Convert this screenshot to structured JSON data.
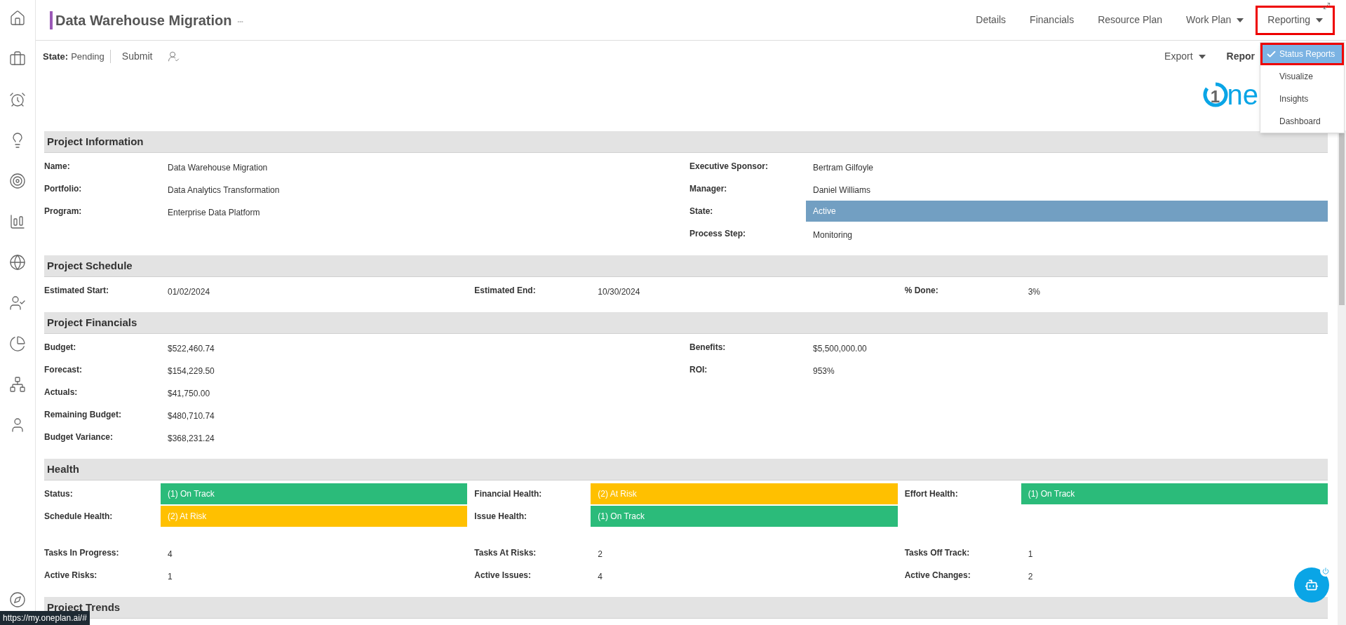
{
  "header": {
    "title": "Data Warehouse Migration",
    "more": "•••",
    "nav": [
      {
        "label": "Details",
        "dropdown": false,
        "selected": false
      },
      {
        "label": "Financials",
        "dropdown": false,
        "selected": false
      },
      {
        "label": "Resource Plan",
        "dropdown": false,
        "selected": false
      },
      {
        "label": "Work Plan",
        "dropdown": true,
        "selected": false
      },
      {
        "label": "Reporting",
        "dropdown": true,
        "selected": true
      }
    ]
  },
  "toolbar": {
    "state_label": "State:",
    "state_value": "Pending",
    "submit": "Submit",
    "export": "Export",
    "reports": "Repor"
  },
  "menu": [
    {
      "label": "Status Reports",
      "selected": true
    },
    {
      "label": "Visualize",
      "selected": false
    },
    {
      "label": "Insights",
      "selected": false
    },
    {
      "label": "Dashboard",
      "selected": false
    }
  ],
  "logo": {
    "mark": "1",
    "text": "ne"
  },
  "sections": [
    {
      "title": "Project Information",
      "blocks": [
        [
          [
            {
              "label": "Name:",
              "value": "Data Warehouse Migration"
            },
            {
              "label": "Portfolio:",
              "value": "Data Analytics Transformation"
            },
            {
              "label": "Program:",
              "value": "Enterprise Data Platform"
            }
          ],
          [
            {
              "label": "Executive Sponsor:",
              "value": "Bertram Gilfoyle"
            },
            {
              "label": "Manager:",
              "value": "Daniel Williams"
            },
            {
              "label": "State:",
              "value": "Active",
              "color": "#729fc2"
            },
            {
              "label": "Process Step:",
              "value": "Monitoring"
            }
          ]
        ]
      ]
    },
    {
      "title": "Project Schedule",
      "blocks": [
        [
          [
            {
              "label": "Estimated Start:",
              "value": "01/02/2024"
            }
          ],
          [
            {
              "label": "Estimated End:",
              "value": "10/30/2024"
            }
          ],
          [
            {
              "label": "% Done:",
              "value": "3%"
            }
          ]
        ]
      ]
    },
    {
      "title": "Project Financials",
      "blocks": [
        [
          [
            {
              "label": "Budget:",
              "value": "$522,460.74"
            },
            {
              "label": "Forecast:",
              "value": "$154,229.50"
            },
            {
              "label": "Actuals:",
              "value": "$41,750.00"
            },
            {
              "label": "Remaining Budget:",
              "value": "$480,710.74"
            },
            {
              "label": "Budget Variance:",
              "value": "$368,231.24"
            }
          ],
          [
            {
              "label": "Benefits:",
              "value": "$5,500,000.00"
            },
            {
              "label": "ROI:",
              "value": "953%"
            }
          ]
        ]
      ]
    },
    {
      "title": "Health",
      "blocks": [
        [
          [
            {
              "label": "Status:",
              "value": "(1) On Track",
              "color": "#2bbb7a"
            },
            {
              "label": "Schedule Health:",
              "value": "(2) At Risk",
              "color": "#ffc000"
            }
          ],
          [
            {
              "label": "Financial Health:",
              "value": "(2) At Risk",
              "color": "#ffc000"
            },
            {
              "label": "Issue Health:",
              "value": "(1) On Track",
              "color": "#2bbb7a"
            }
          ],
          [
            {
              "label": "Effort Health:",
              "value": "(1) On Track",
              "color": "#2bbb7a"
            }
          ]
        ],
        [
          [
            {
              "label": "Tasks In Progress:",
              "value": "4"
            },
            {
              "label": "Active Risks:",
              "value": "1"
            }
          ],
          [
            {
              "label": "Tasks At Risks:",
              "value": "2"
            },
            {
              "label": "Active Issues:",
              "value": "4"
            }
          ],
          [
            {
              "label": "Tasks Off Track:",
              "value": "1"
            },
            {
              "label": "Active Changes:",
              "value": "2"
            }
          ]
        ]
      ]
    },
    {
      "title": "Project Trends"
    }
  ],
  "status_url": "https://my.oneplan.ai/#"
}
